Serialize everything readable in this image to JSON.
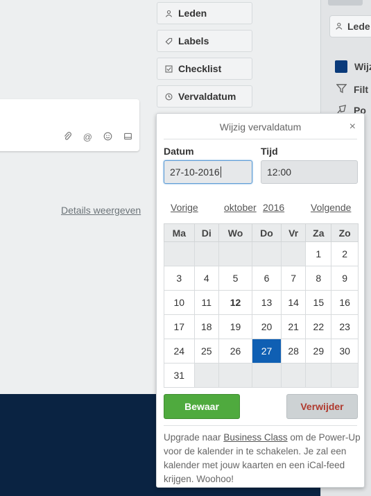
{
  "sidebar_buttons": [
    {
      "label": "Leden",
      "icon": "person-icon"
    },
    {
      "label": "Labels",
      "icon": "tag-icon"
    },
    {
      "label": "Checklist",
      "icon": "checkbox-icon"
    },
    {
      "label": "Vervaldatum",
      "icon": "clock-icon"
    }
  ],
  "card": {
    "details_link": "Details weergeven"
  },
  "right_panel": {
    "leden": "Lede",
    "items": [
      "Wijz",
      "Filt",
      "Po"
    ]
  },
  "popover": {
    "title": "Wijzig vervaldatum",
    "close": "×",
    "date_label": "Datum",
    "time_label": "Tijd",
    "date_value": "27-10-2016",
    "time_value": "12:00",
    "prev": "Vorige",
    "month": "oktober",
    "year": "2016",
    "next": "Volgende",
    "weekdays": [
      "Ma",
      "Di",
      "Wo",
      "Do",
      "Vr",
      "Za",
      "Zo"
    ],
    "weeks": [
      [
        "",
        "",
        "",
        "",
        "",
        "1",
        "2"
      ],
      [
        "3",
        "4",
        "5",
        "6",
        "7",
        "8",
        "9"
      ],
      [
        "10",
        "11",
        "12",
        "13",
        "14",
        "15",
        "16"
      ],
      [
        "17",
        "18",
        "19",
        "20",
        "21",
        "22",
        "23"
      ],
      [
        "24",
        "25",
        "26",
        "27",
        "28",
        "29",
        "30"
      ],
      [
        "31",
        "",
        "",
        "",
        "",
        "",
        ""
      ]
    ],
    "today": "12",
    "selected": "27",
    "save_label": "Bewaar",
    "delete_label": "Verwijder",
    "upgrade_before": "Upgrade naar ",
    "upgrade_link": "Business Class",
    "upgrade_after": " om de Power-Up voor de kalender in te schakelen. Je zal een kalender met jouw kaarten en een iCal-feed krijgen. Woohoo!"
  },
  "colors": {
    "accent": "#0f5fb3",
    "save": "#4faa3e",
    "delete_text": "#b03a2e",
    "navy": "#0a2342"
  }
}
